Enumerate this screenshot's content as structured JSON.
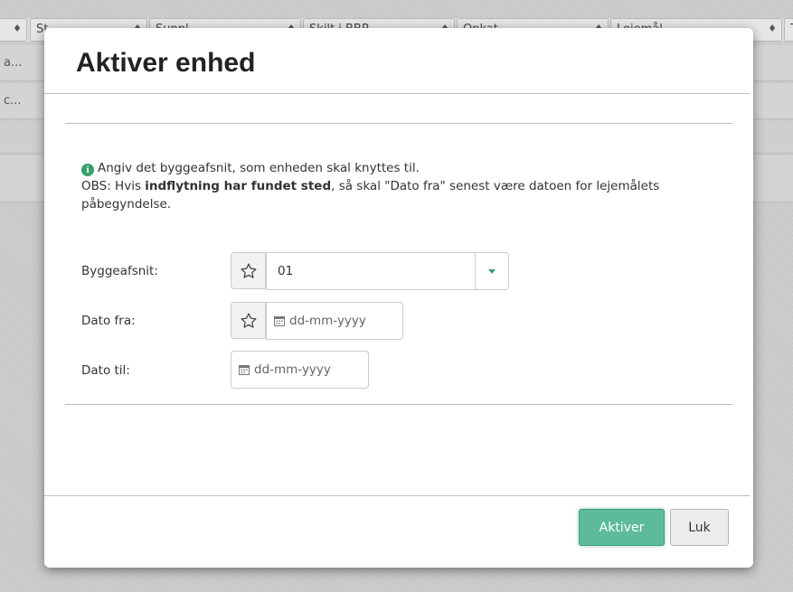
{
  "background": {
    "header_columns": [
      {
        "label": "",
        "sort_icon": "sort-icon"
      },
      {
        "label": "St",
        "sort_icon": "sort-icon"
      },
      {
        "label": "Suppl",
        "sort_icon": "sort-icon"
      },
      {
        "label": "Skilt i BBR",
        "sort_icon": "sort-icon"
      },
      {
        "label": "Opkat",
        "sort_icon": "sort-icon"
      },
      {
        "label": "Lejemål",
        "sort_icon": "sort-icon"
      },
      {
        "label": "T",
        "sort_icon": "sort-icon"
      }
    ],
    "rows": [
      "a...",
      "c..."
    ]
  },
  "modal": {
    "title": "Aktiver enhed",
    "info": {
      "icon": "info-icon",
      "line1": "Angiv det byggeafsnit, som enheden skal knyttes til.",
      "obs_prefix": "OBS: Hvis ",
      "obs_bold": "indflytning har fundet sted",
      "obs_suffix": ", så skal \"Dato fra\" senest være datoen for lejemålets påbegyndelse."
    },
    "fields": {
      "byggeafsnit": {
        "label": "Byggeafsnit:",
        "value": "01"
      },
      "dato_fra": {
        "label": "Dato fra:",
        "placeholder": "dd-mm-yyyy"
      },
      "dato_til": {
        "label": "Dato til:",
        "placeholder": "dd-mm-yyyy"
      }
    },
    "buttons": {
      "primary": "Aktiver",
      "secondary": "Luk"
    }
  },
  "colors": {
    "accent": "#5dbb9a",
    "info_icon": "#3a9e6b"
  }
}
